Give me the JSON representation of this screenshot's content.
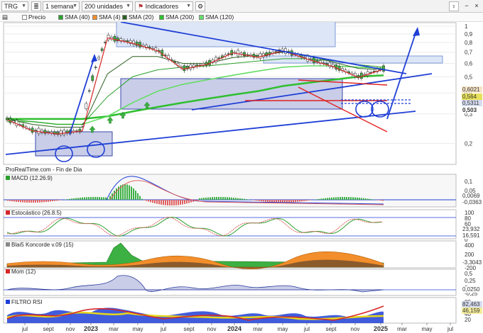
{
  "toolbar": {
    "symbol": "TRG",
    "timeframe": "1 semana",
    "units": "200 unidades",
    "indicators": "Indicadores"
  },
  "legend": {
    "price": "Precio",
    "sma40": "SMA (40)",
    "sma4": "SMA (4)",
    "sma20": "SMA (20)",
    "sma200": "SMA (200)",
    "sma120": "SMA (120)"
  },
  "colors": {
    "price": "#d62728",
    "sma40": "#2ca02c",
    "sma4": "#f28e2b",
    "sma20": "#2e5e1f",
    "sma200": "#2fbf2f",
    "sma120": "#66dd66",
    "trend": "#1f3fd6"
  },
  "source_label": "ProRealTime.com - Fin de Dia",
  "x_axis": [
    "jul",
    "sept",
    "nov",
    "2023",
    "mar",
    "may",
    "jul",
    "sept",
    "nov",
    "2024",
    "mar",
    "may",
    "jul",
    "sept",
    "nov",
    "2025",
    "mar",
    "may",
    "jul"
  ],
  "panels": [
    {
      "id": "price",
      "title": "",
      "ticks": [
        "1",
        "0,9",
        "0,8",
        "0,7",
        "0,6",
        "0,5",
        "0,4",
        "0,3",
        "0,2"
      ],
      "price_labels": [
        "0,6021",
        "0,564",
        "0,5311",
        "0,503"
      ]
    },
    {
      "id": "macd",
      "title": "MACD (12.26.9)",
      "ticks": [
        "0,1",
        "0,05",
        "0"
      ],
      "values": [
        "0,0069",
        "-0,0363"
      ]
    },
    {
      "id": "stoch",
      "title": "Estocástico (26.8.5)",
      "ticks": [
        "100",
        "80",
        "60",
        "40",
        "20",
        "0"
      ],
      "values": [
        "23,932",
        "16,591"
      ]
    },
    {
      "id": "koncorde",
      "title": "Blai5 Koncorde v.09 (15)",
      "ticks": [
        "400",
        "200",
        "0",
        "-200"
      ],
      "values": [
        "-3,3043"
      ]
    },
    {
      "id": "mom",
      "title": "Mom (12)",
      "ticks": [
        "0,5",
        "0,25",
        "0",
        "-0,25"
      ],
      "values": [
        "0,0250"
      ]
    },
    {
      "id": "rsi",
      "title": "FILTRO RSI",
      "ticks": [
        "80",
        "60",
        "40",
        "20"
      ],
      "values": [
        "82,463",
        "46,159"
      ]
    }
  ],
  "chart_data": {
    "type": "line",
    "title": "TRG",
    "xlabel": "",
    "ylabel": "",
    "x": [
      "jul",
      "sept",
      "nov",
      "2023",
      "mar",
      "may",
      "jul",
      "sept",
      "nov",
      "2024",
      "mar",
      "may",
      "jul",
      "sept",
      "nov",
      "2025"
    ],
    "series": [
      {
        "name": "Precio",
        "values": [
          0.28,
          0.24,
          0.23,
          0.24,
          0.86,
          0.8,
          0.72,
          0.56,
          0.6,
          0.7,
          0.66,
          0.72,
          0.64,
          0.58,
          0.5,
          0.56
        ]
      },
      {
        "name": "SMA (40)",
        "values": [
          0.28,
          0.27,
          0.26,
          0.26,
          0.38,
          0.5,
          0.55,
          0.57,
          0.58,
          0.6,
          0.62,
          0.64,
          0.64,
          0.62,
          0.59,
          0.57
        ]
      },
      {
        "name": "SMA (20)",
        "values": [
          0.28,
          0.26,
          0.25,
          0.25,
          0.52,
          0.66,
          0.66,
          0.6,
          0.6,
          0.65,
          0.67,
          0.7,
          0.67,
          0.61,
          0.56,
          0.55
        ]
      },
      {
        "name": "SMA (200)",
        "values": [
          0.28,
          0.28,
          0.28,
          0.28,
          0.29,
          0.31,
          0.33,
          0.35,
          0.37,
          0.39,
          0.41,
          0.44,
          0.46,
          0.48,
          0.5,
          0.51
        ]
      },
      {
        "name": "SMA (120)",
        "values": [
          0.27,
          0.27,
          0.26,
          0.26,
          0.29,
          0.35,
          0.41,
          0.45,
          0.48,
          0.51,
          0.54,
          0.57,
          0.58,
          0.58,
          0.57,
          0.56
        ]
      }
    ],
    "ylim": [
      0.15,
      1.05
    ],
    "scale": "log",
    "last_values": {
      "Precio": 0.503,
      "high_band": 0.6021,
      "level_1": 0.564,
      "level_2": 0.5311
    }
  }
}
